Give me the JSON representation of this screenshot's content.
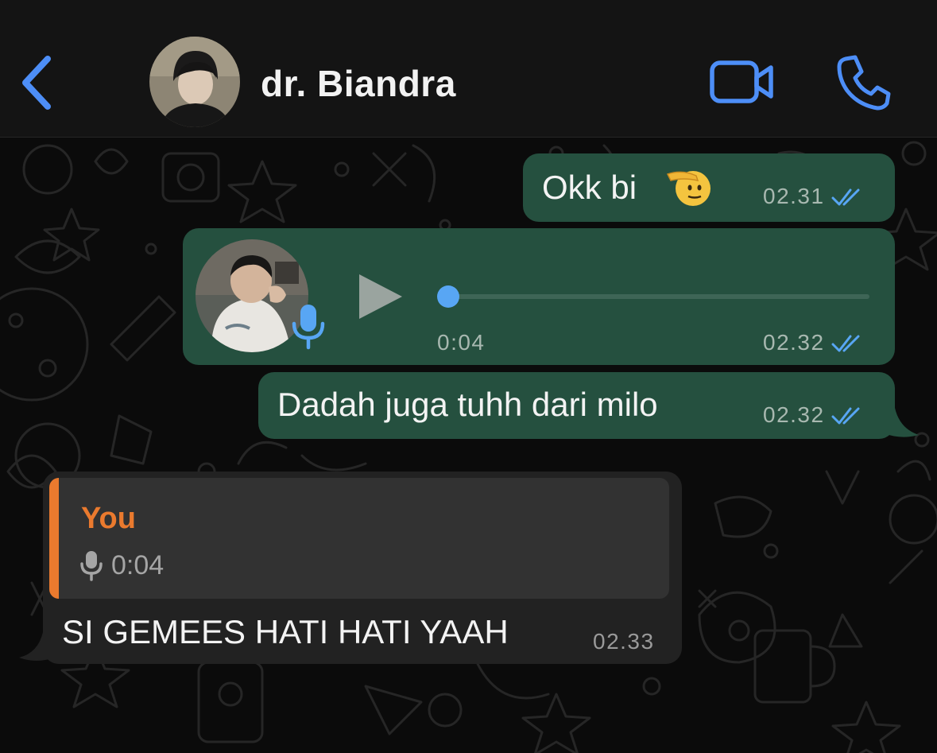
{
  "header": {
    "contact_name": "dr. Biandra",
    "icons": {
      "back": "chevron-left-icon",
      "video": "video-camera-icon",
      "call": "phone-icon"
    },
    "accent_color": "#4d8ef7"
  },
  "messages": [
    {
      "type": "text",
      "direction": "outgoing",
      "text": "Okk bi",
      "emoji": "saluting-face",
      "time": "02.31",
      "status": "read"
    },
    {
      "type": "voice",
      "direction": "outgoing",
      "duration": "0:04",
      "progress": 0,
      "time": "02.32",
      "status": "read"
    },
    {
      "type": "text",
      "direction": "outgoing",
      "text": "Dadah juga tuhh dari milo",
      "time": "02.32",
      "status": "read"
    },
    {
      "type": "text",
      "direction": "incoming",
      "reply": {
        "author": "You",
        "preview": "0:04",
        "preview_icon": "microphone-icon"
      },
      "text": "SI GEMEES HATI HATI YAAH",
      "time": "02.33"
    }
  ],
  "colors": {
    "outgoing_bubble": "#25503f",
    "incoming_bubble": "#222222",
    "read_ticks": "#58a6f4",
    "reply_author": "#ea7a2e"
  }
}
